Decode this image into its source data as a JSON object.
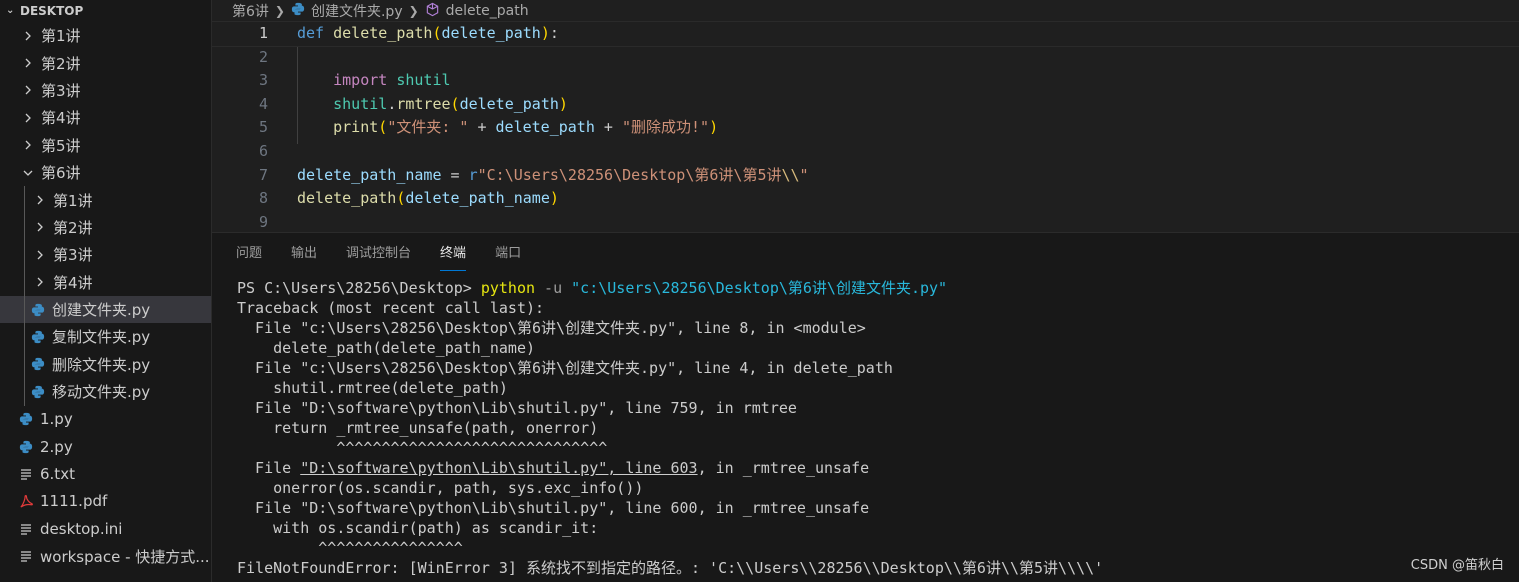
{
  "sidebar": {
    "header": "DESKTOP",
    "items": [
      {
        "label": "第1讲",
        "type": "folder"
      },
      {
        "label": "第2讲",
        "type": "folder"
      },
      {
        "label": "第3讲",
        "type": "folder"
      },
      {
        "label": "第4讲",
        "type": "folder"
      },
      {
        "label": "第5讲",
        "type": "folder"
      },
      {
        "label": "第6讲",
        "type": "folder-open"
      },
      {
        "label": "第1讲",
        "type": "folder"
      },
      {
        "label": "第2讲",
        "type": "folder"
      },
      {
        "label": "第3讲",
        "type": "folder"
      },
      {
        "label": "第4讲",
        "type": "folder"
      },
      {
        "label": "创建文件夹.py",
        "type": "python",
        "selected": true
      },
      {
        "label": "复制文件夹.py",
        "type": "python"
      },
      {
        "label": "删除文件夹.py",
        "type": "python"
      },
      {
        "label": "移动文件夹.py",
        "type": "python"
      },
      {
        "label": "1.py",
        "type": "python"
      },
      {
        "label": "2.py",
        "type": "python"
      },
      {
        "label": "6.txt",
        "type": "text"
      },
      {
        "label": "1111.pdf",
        "type": "pdf"
      },
      {
        "label": "desktop.ini",
        "type": "text"
      },
      {
        "label": "workspace - 快捷方式...",
        "type": "text"
      }
    ]
  },
  "breadcrumb": {
    "folder": "第6讲",
    "file": "创建文件夹.py",
    "symbol": "delete_path"
  },
  "editor": {
    "line_numbers": [
      "1",
      "2",
      "3",
      "4",
      "5",
      "6",
      "7",
      "8",
      "9"
    ],
    "l1_def": "def",
    "l1_fn": "delete_path",
    "l1_param": "delete_path",
    "l3_import": "import",
    "l3_mod": "shutil",
    "l4_mod": "shutil",
    "l4_fn": "rmtree",
    "l4_arg": "delete_path",
    "l5_fn": "print",
    "l5_str": "\"文件夹: \"",
    "l5_var": "delete_path",
    "l5_str2": "\"删除成功!\"",
    "l7_var": "delete_path_name",
    "l7_r": "r",
    "l7_s1": "\"C:\\",
    "l7_s2": "Users\\28256\\Desktop\\",
    "l7_s3": "第6讲\\",
    "l7_s4": "第5讲",
    "l7_s5": "\\\\",
    "l7_s6": "\"",
    "l8_fn": "delete_path",
    "l8_arg": "delete_path_name"
  },
  "panel": {
    "tabs": [
      "问题",
      "输出",
      "调试控制台",
      "终端",
      "端口"
    ],
    "active_tab": "终端"
  },
  "terminal": {
    "prompt": "PS C:\\Users\\28256\\Desktop> ",
    "cmd": "python",
    "flag": " -u ",
    "arg": "\"c:\\Users\\28256\\Desktop\\第6讲\\创建文件夹.py\"",
    "lines": [
      "Traceback (most recent call last):",
      "  File \"c:\\Users\\28256\\Desktop\\第6讲\\创建文件夹.py\", line 8, in <module>",
      "    delete_path(delete_path_name)",
      "  File \"c:\\Users\\28256\\Desktop\\第6讲\\创建文件夹.py\", line 4, in delete_path",
      "    shutil.rmtree(delete_path)",
      "  File \"D:\\software\\python\\Lib\\shutil.py\", line 759, in rmtree",
      "    return _rmtree_unsafe(path, onerror)",
      "           ^^^^^^^^^^^^^^^^^^^^^^^^^^^^^^",
      "  File \"D:\\software\\python\\Lib\\shutil.py\", line 603, in _rmtree_unsafe",
      "    onerror(os.scandir, path, sys.exc_info())",
      "  File \"D:\\software\\python\\Lib\\shutil.py\", line 600, in _rmtree_unsafe",
      "    with os.scandir(path) as scandir_it:",
      "         ^^^^^^^^^^^^^^^^",
      "FileNotFoundError: [WinError 3] 系统找不到指定的路径。: 'C:\\\\Users\\\\28256\\\\Desktop\\\\第6讲\\\\第5讲\\\\\\\\'"
    ]
  },
  "watermark": "CSDN @笛秋白",
  "colors": {
    "accent": "#0078d4",
    "python_icon": "#3c8dc5",
    "pdf_icon": "#e03a3a"
  }
}
